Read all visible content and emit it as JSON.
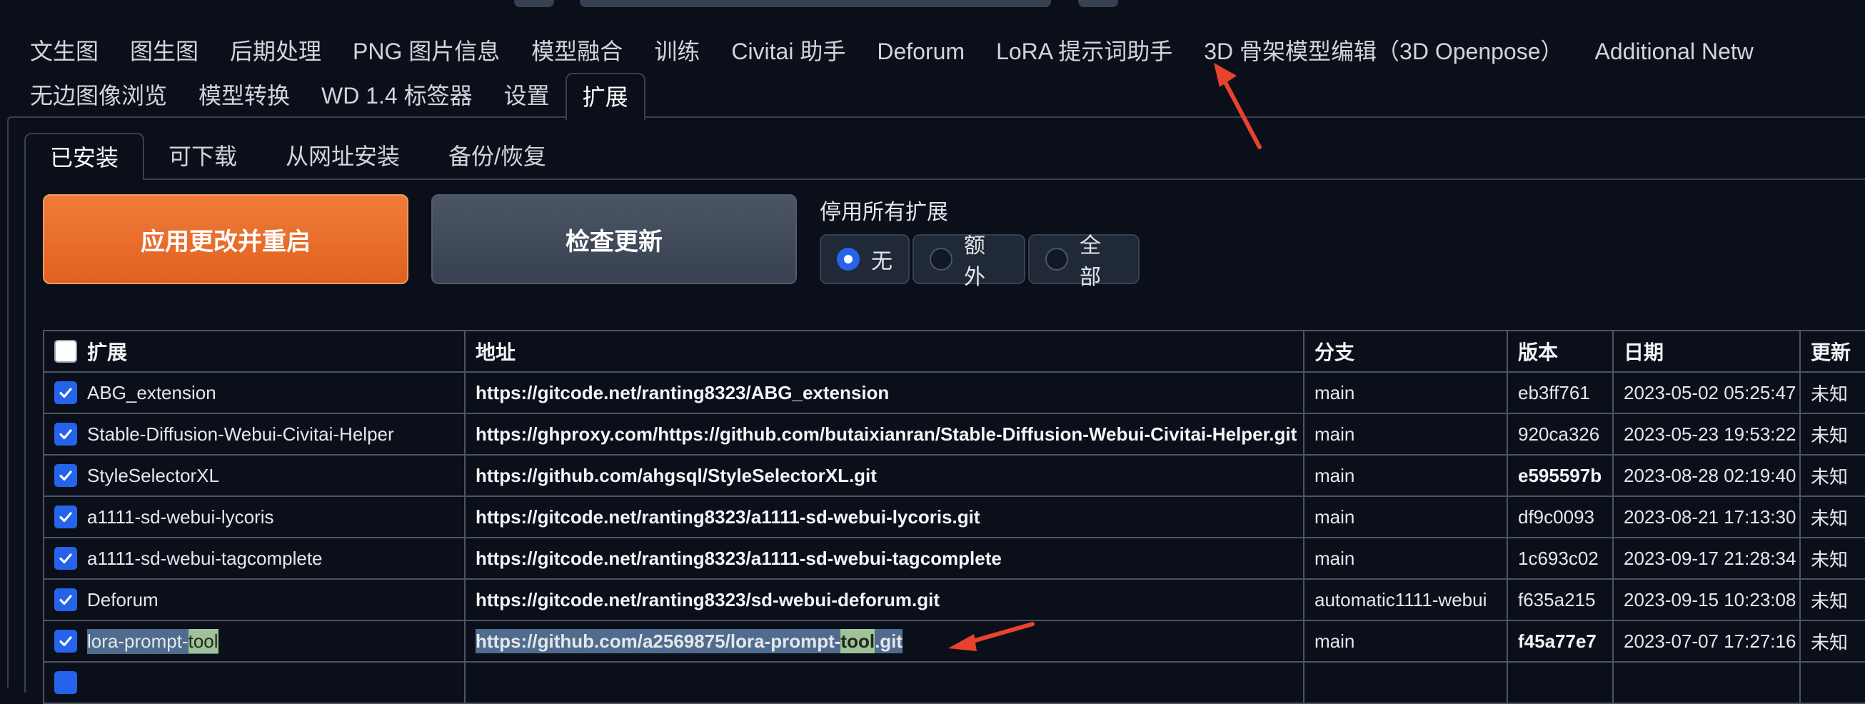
{
  "main_tabs": {
    "row1": [
      "文生图",
      "图生图",
      "后期处理",
      "PNG 图片信息",
      "模型融合",
      "训练",
      "Civitai 助手",
      "Deforum",
      "LoRA 提示词助手",
      "3D 骨架模型编辑（3D Openpose）",
      "Additional Netw"
    ],
    "row2": [
      "无边图像浏览",
      "模型转换",
      "WD 1.4 标签器",
      "设置",
      "扩展"
    ],
    "active": "扩展"
  },
  "sub_tabs": {
    "items": [
      "已安装",
      "可下载",
      "从网址安装",
      "备份/恢复"
    ],
    "active": "已安装"
  },
  "buttons": {
    "apply": "应用更改并重启",
    "check": "检查更新"
  },
  "disable_all": {
    "label": "停用所有扩展",
    "options": [
      "无",
      "额外",
      "全部"
    ],
    "selected": "无"
  },
  "table": {
    "headers": [
      "扩展",
      "地址",
      "分支",
      "版本",
      "日期",
      "更新"
    ],
    "rows": [
      {
        "name": "ABG_extension",
        "url": "https://gitcode.net/ranting8323/ABG_extension",
        "branch": "main",
        "version": "eb3ff761",
        "date": "2023-05-02 05:25:47",
        "update": "未知",
        "checked": true,
        "version_bold": false
      },
      {
        "name": "Stable-Diffusion-Webui-Civitai-Helper",
        "url": "https://ghproxy.com/https://github.com/butaixianran/Stable-Diffusion-Webui-Civitai-Helper.git",
        "branch": "main",
        "version": "920ca326",
        "date": "2023-05-23 19:53:22",
        "update": "未知",
        "checked": true,
        "version_bold": false
      },
      {
        "name": "StyleSelectorXL",
        "url": "https://github.com/ahgsql/StyleSelectorXL.git",
        "branch": "main",
        "version": "e595597b",
        "date": "2023-08-28 02:19:40",
        "update": "未知",
        "checked": true,
        "version_bold": true
      },
      {
        "name": "a1111-sd-webui-lycoris",
        "url": "https://gitcode.net/ranting8323/a1111-sd-webui-lycoris.git",
        "branch": "main",
        "version": "df9c0093",
        "date": "2023-08-21 17:13:30",
        "update": "未知",
        "checked": true,
        "version_bold": false
      },
      {
        "name": "a1111-sd-webui-tagcomplete",
        "url": "https://gitcode.net/ranting8323/a1111-sd-webui-tagcomplete",
        "branch": "main",
        "version": "1c693c02",
        "date": "2023-09-17 21:28:34",
        "update": "未知",
        "checked": true,
        "version_bold": false
      },
      {
        "name": "Deforum",
        "url": "https://gitcode.net/ranting8323/sd-webui-deforum.git",
        "branch": "automatic1111-webui",
        "version": "f635a215",
        "date": "2023-09-15 10:23:08",
        "update": "未知",
        "checked": true,
        "version_bold": false
      },
      {
        "name_parts": [
          "lora-prompt-",
          "tool"
        ],
        "url_parts": [
          "https://github.com/a2569875/lora-prompt-",
          "tool",
          ".git"
        ],
        "branch": "main",
        "version": "f45a77e7",
        "date": "2023-07-07 17:27:16",
        "update": "未知",
        "checked": true,
        "version_bold": true
      }
    ]
  },
  "colors": {
    "background": "#0b0f19",
    "accent_orange": "#e8702a",
    "checkbox_blue": "#2563eb",
    "annotation_red": "#e8432e"
  }
}
